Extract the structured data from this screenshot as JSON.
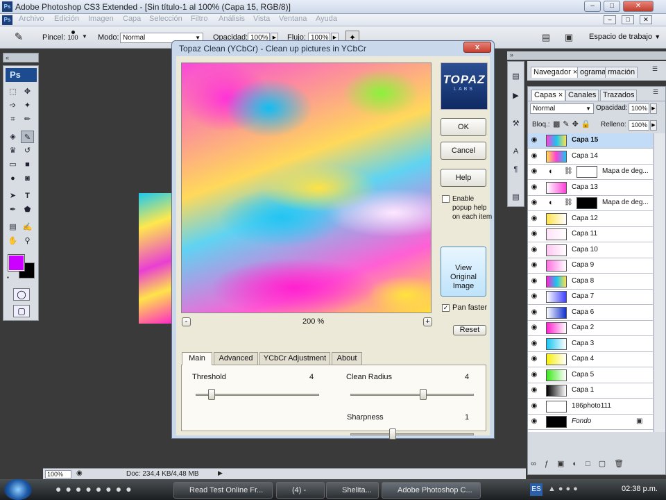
{
  "app": {
    "title": "Adobe Photoshop CS3 Extended - [Sin título-1 al 100% (Capa 15, RGB/8)]",
    "badge": "Ps"
  },
  "menu": [
    "Archivo",
    "Edición",
    "Imagen",
    "Capa",
    "Selección",
    "Filtro",
    "Análisis",
    "Vista",
    "Ventana",
    "Ayuda"
  ],
  "options": {
    "brush_label": "Pincel:",
    "brush_size": "100",
    "mode_label": "Modo:",
    "mode_value": "Normal",
    "opacity_label": "Opacidad:",
    "opacity_value": "100%",
    "flow_label": "Flujo:",
    "flow_value": "100%",
    "workspace_label": "Espacio de trabajo"
  },
  "colors": {
    "foreground": "#cc00ff",
    "background": "#000000"
  },
  "status": {
    "zoom": "100%",
    "doc": "Doc: 234,4 KB/4,48 MB"
  },
  "dialog": {
    "title": "Topaz Clean (YCbCr) - Clean up pictures in YCbCr",
    "close": "x",
    "logo_text": "TOPAZ",
    "logo_sub": "LABS",
    "buttons": {
      "ok": "OK",
      "cancel": "Cancel",
      "help": "Help",
      "view_original": "View Original Image",
      "reset": "Reset"
    },
    "enable_popup": "Enable popup help on each item",
    "pan_faster": "Pan faster",
    "zoom_minus": "-",
    "zoom_plus": "+",
    "zoom": "200 %",
    "tabs": [
      "Main",
      "Advanced",
      "YCbCr Adjustment",
      "About"
    ],
    "threshold": {
      "label": "Threshold",
      "value": "4"
    },
    "clean_radius": {
      "label": "Clean Radius",
      "value": "4"
    },
    "sharpness": {
      "label": "Sharpness",
      "value": "1"
    }
  },
  "panels": {
    "navigator_tabs": [
      "Navegador",
      "ograma",
      "rmación"
    ],
    "layer_tabs": [
      "Capas",
      "Canales",
      "Trazados"
    ],
    "blend_mode": "Normal",
    "opacity_label": "Opacidad:",
    "opacity_value": "100%",
    "lock_label": "Bloq.:",
    "fill_label": "Relleno:",
    "fill_value": "100%"
  },
  "layers": [
    {
      "name": "Capa 15",
      "thumb": "linear-gradient(90deg,#ff3fd9,#17c6f2,#ffe24c)",
      "selected": true
    },
    {
      "name": "Capa 14",
      "thumb": "linear-gradient(90deg,#ffe24c,#ff3fd9,#17c6f2)"
    },
    {
      "name": "Mapa de deg...",
      "thumb": "#ffffff",
      "adjust": true
    },
    {
      "name": "Capa 13",
      "thumb": "linear-gradient(90deg,#ffffff,#ff3fd9)"
    },
    {
      "name": "Mapa de deg...",
      "thumb": "#000000",
      "adjust": true
    },
    {
      "name": "Capa 12",
      "thumb": "linear-gradient(90deg,#ffe24c,#ffffff)"
    },
    {
      "name": "Capa 11",
      "thumb": "linear-gradient(90deg,#ffe3f8,#ffffff)"
    },
    {
      "name": "Capa 10",
      "thumb": "linear-gradient(90deg,#ffc6f2,#ffffff)"
    },
    {
      "name": "Capa 9",
      "thumb": "linear-gradient(90deg,#ff6fe0,#ffffff)"
    },
    {
      "name": "Capa 8",
      "thumb": "linear-gradient(90deg,#ff21cf,#17c6f2,#ffe24c)"
    },
    {
      "name": "Capa 7",
      "thumb": "linear-gradient(90deg,#ffffff,#4040ff)"
    },
    {
      "name": "Capa 6",
      "thumb": "linear-gradient(90deg,#ffffff,#1030d0)"
    },
    {
      "name": "Capa 2",
      "thumb": "linear-gradient(90deg,#ff21cf,#ffffff)"
    },
    {
      "name": "Capa 3",
      "thumb": "linear-gradient(90deg,#17c6f2,#ffffff)"
    },
    {
      "name": "Capa 4",
      "thumb": "linear-gradient(90deg,#f7f00c,#ffffff)"
    },
    {
      "name": "Capa 5",
      "thumb": "linear-gradient(90deg,#3ce81c,#ffffff)"
    },
    {
      "name": "Capa 1",
      "thumb": "linear-gradient(90deg,#000000,#ffffff)"
    },
    {
      "name": "186photo111",
      "thumb": "#ffffff"
    },
    {
      "name": "Fondo",
      "thumb": "#000000",
      "locked": true
    }
  ],
  "taskbar": {
    "tasks": [
      "Read Test Online Fr...",
      "(4) -",
      "Shelita...",
      "Adobe Photoshop C..."
    ],
    "lang": "ES",
    "time": "02:38 p.m."
  }
}
